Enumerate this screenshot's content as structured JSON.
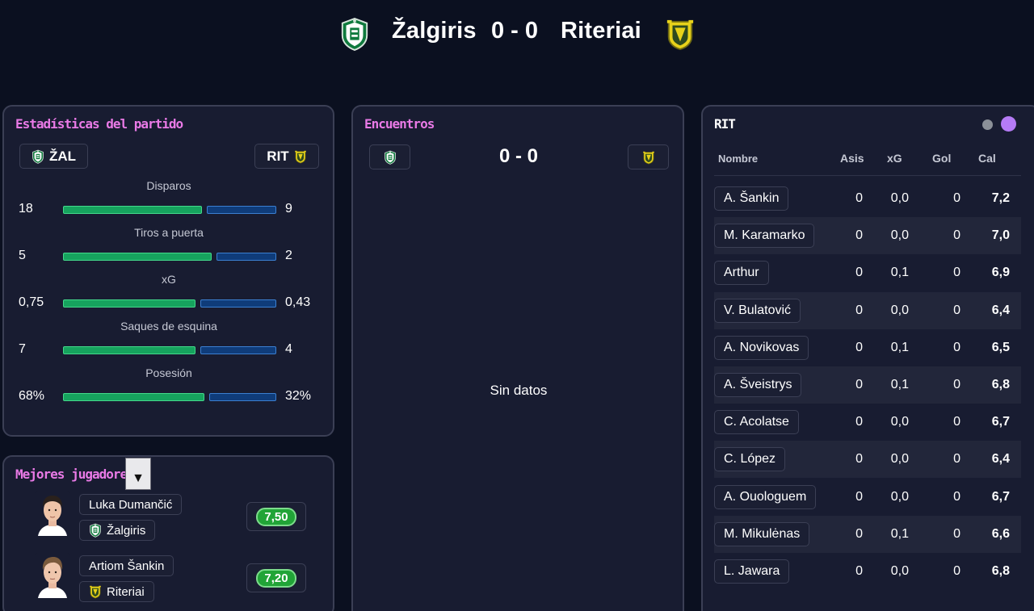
{
  "header": {
    "home_team": "Žalgiris",
    "score": "0 - 0",
    "away_team": "Riteriai"
  },
  "colors": {
    "accent_title": "#e97ae6",
    "home_bar": "#16a35e",
    "away_bar": "#0f3c7a",
    "rating_green": "#21a437",
    "panel_bg": "#181c31",
    "page_bg": "#0b1020",
    "toggle_active": "#b57bf5"
  },
  "stats_panel": {
    "title": "Estadísticas del partido",
    "home_chip": "ŽAL",
    "away_chip": "RIT",
    "stats": [
      {
        "label": "Disparos",
        "home": "18",
        "away": "9",
        "home_value": 18,
        "away_value": 9
      },
      {
        "label": "Tiros a puerta",
        "home": "5",
        "away": "2",
        "home_value": 5,
        "away_value": 2
      },
      {
        "label": "xG",
        "home": "0,75",
        "away": "0,43",
        "home_value": 0.75,
        "away_value": 0.43
      },
      {
        "label": "Saques de esquina",
        "home": "7",
        "away": "4",
        "home_value": 7,
        "away_value": 4
      },
      {
        "label": "Posesión",
        "home": "68%",
        "away": "32%",
        "home_value": 68,
        "away_value": 32
      }
    ]
  },
  "encounters_panel": {
    "title": "Encuentros",
    "score": "0 - 0",
    "empty_text": "Sin datos"
  },
  "best_players_panel": {
    "title": "Mejores jugadores",
    "dropdown_icon": "triangle-down-icon",
    "players": [
      {
        "name": "Luka Dumančić",
        "team": "Žalgiris",
        "rating": "7,50"
      },
      {
        "name": "Artiom Šankin",
        "team": "Riteriai",
        "rating": "7,20"
      }
    ]
  },
  "team_table": {
    "title": "RIT",
    "columns": [
      "Nombre",
      "Asis",
      "xG",
      "Gol",
      "Cal"
    ],
    "rows": [
      {
        "name": "A. Šankin",
        "asis": "0",
        "xg": "0,0",
        "gol": "0",
        "cal": "7,2"
      },
      {
        "name": "M. Karamarko",
        "asis": "0",
        "xg": "0,0",
        "gol": "0",
        "cal": "7,0"
      },
      {
        "name": "Arthur",
        "asis": "0",
        "xg": "0,1",
        "gol": "0",
        "cal": "6,9"
      },
      {
        "name": "V. Bulatović",
        "asis": "0",
        "xg": "0,0",
        "gol": "0",
        "cal": "6,4"
      },
      {
        "name": "A. Novikovas",
        "asis": "0",
        "xg": "0,1",
        "gol": "0",
        "cal": "6,5"
      },
      {
        "name": "A. Šveistrys",
        "asis": "0",
        "xg": "0,1",
        "gol": "0",
        "cal": "6,8"
      },
      {
        "name": "C. Acolatse",
        "asis": "0",
        "xg": "0,0",
        "gol": "0",
        "cal": "6,7"
      },
      {
        "name": "C. López",
        "asis": "0",
        "xg": "0,0",
        "gol": "0",
        "cal": "6,4"
      },
      {
        "name": "A. Ouologuem",
        "asis": "0",
        "xg": "0,0",
        "gol": "0",
        "cal": "6,7"
      },
      {
        "name": "M. Mikulėnas",
        "asis": "0",
        "xg": "0,1",
        "gol": "0",
        "cal": "6,6"
      },
      {
        "name": "L. Jawara",
        "asis": "0",
        "xg": "0,0",
        "gol": "0",
        "cal": "6,8"
      }
    ]
  }
}
